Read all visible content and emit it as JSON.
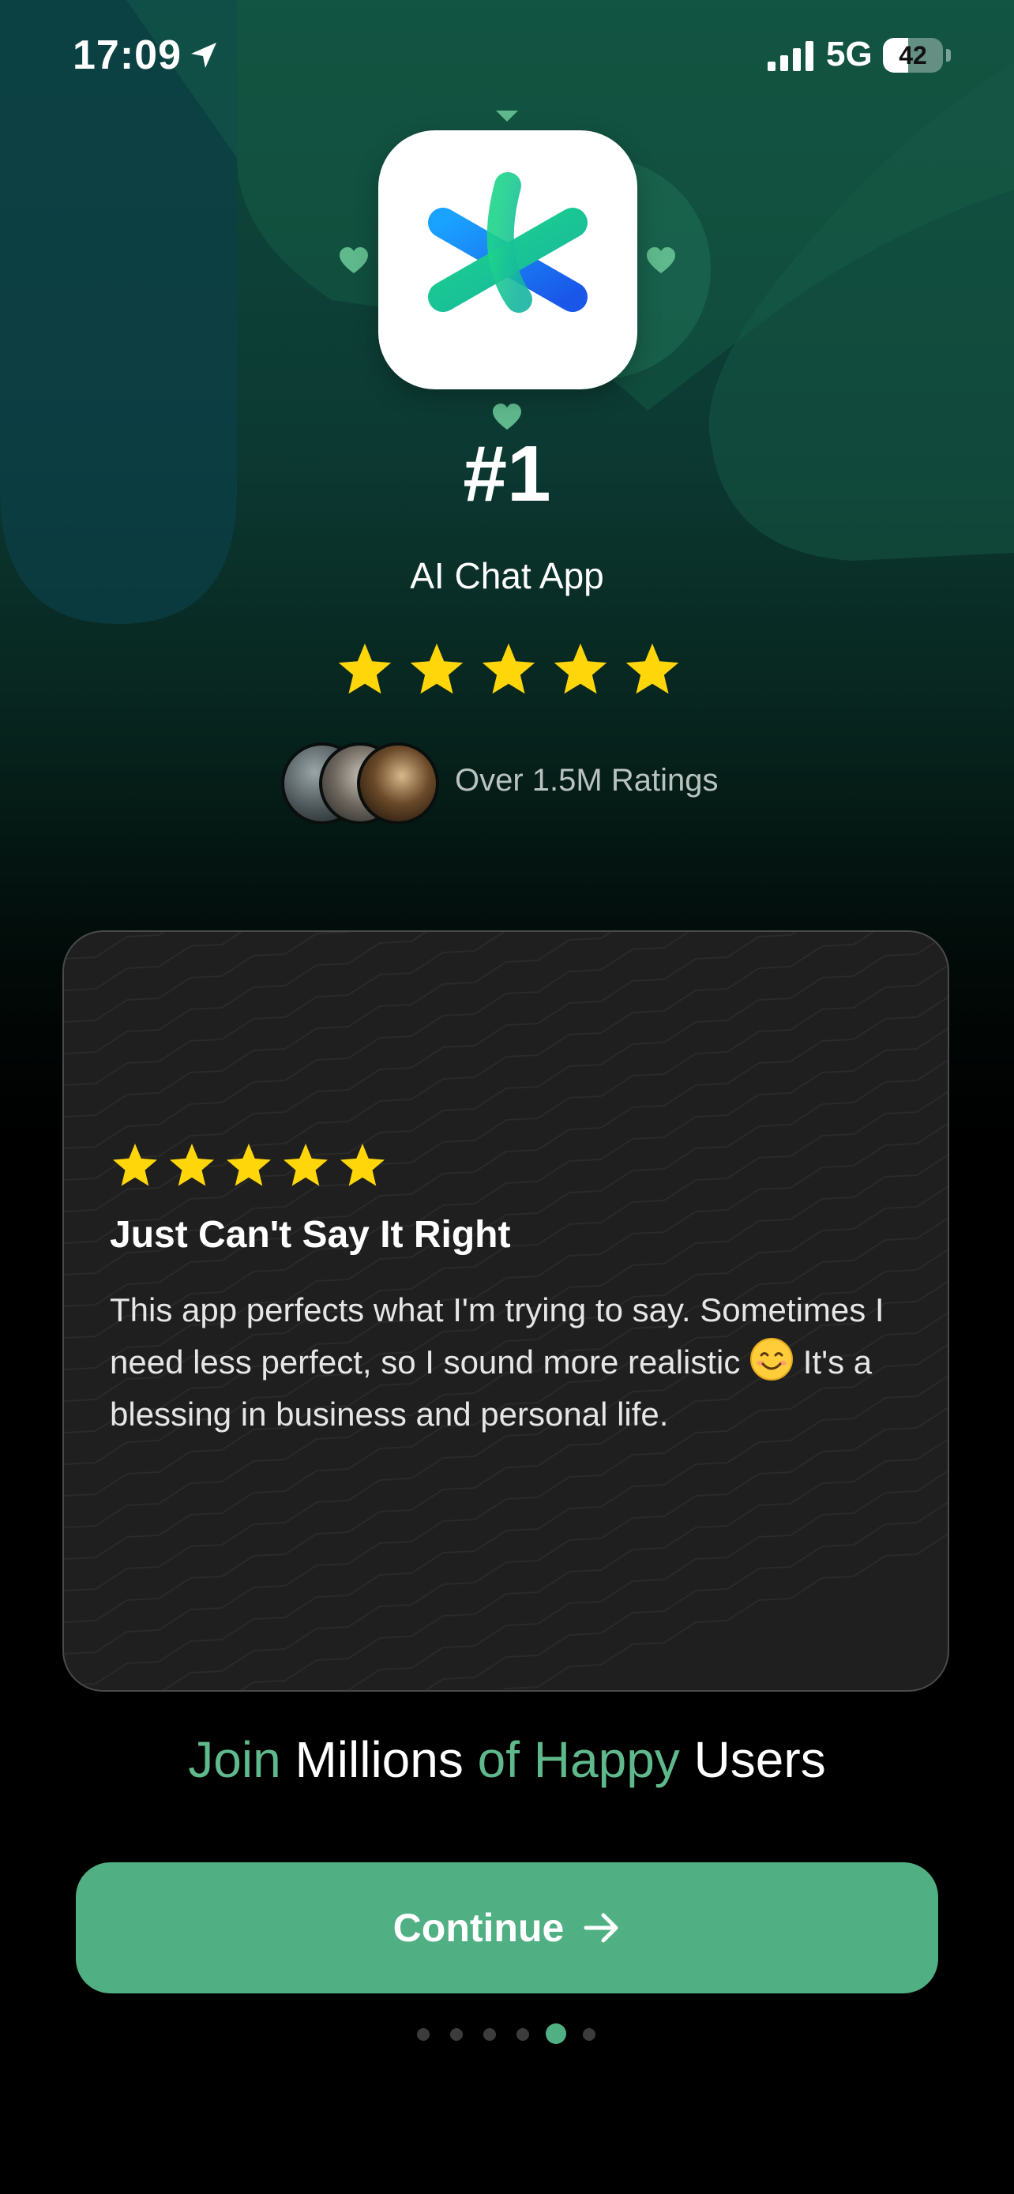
{
  "status_bar": {
    "time": "17:09",
    "network": "5G",
    "battery": "42",
    "battery_level": 0.42
  },
  "hero": {
    "app_icon": "star-logo-icon",
    "rank": "#1",
    "category": "AI Chat App",
    "rating_stars": 5,
    "ratings_text": "Over 1.5M Ratings"
  },
  "review": {
    "stars": 5,
    "title": "Just Can't Say It Right",
    "body_part1": "This app perfects what I'm trying to say. Sometimes I need less perfect, so I sound more realistic",
    "emoji": "smiling-face-icon",
    "body_part2": "It's a blessing in business and personal life."
  },
  "headline": {
    "word1": "Join",
    "word2": "Millions",
    "word3": "of Happy",
    "word4": "Users"
  },
  "cta": {
    "label": "Continue"
  },
  "pagination": {
    "total": 6,
    "active_index": 4
  },
  "colors": {
    "accent": "#51b083",
    "headline_green": "#5fb98c",
    "star": "#ffd60a",
    "card_bg": "#1f1f1f"
  }
}
